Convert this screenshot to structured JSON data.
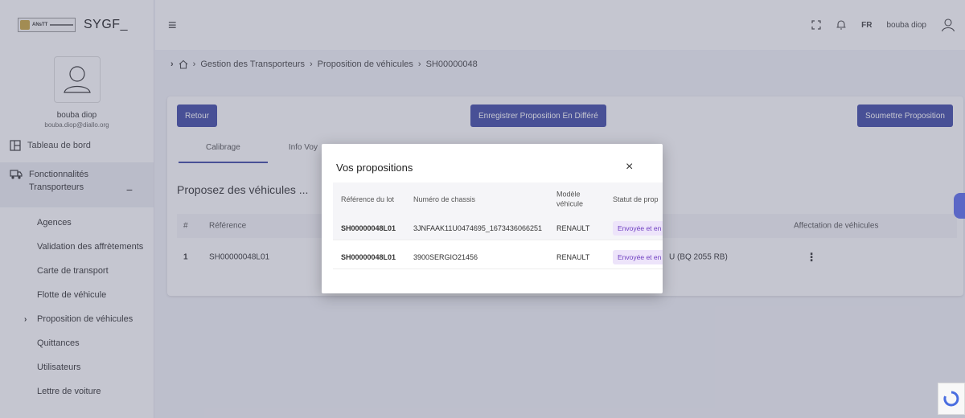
{
  "brand": {
    "logo_text": "ANsTT",
    "title": "SYGF_"
  },
  "user": {
    "name": "bouba diop",
    "email": "bouba.diop@diallo.org"
  },
  "sidebar": {
    "dashboard": "Tableau de bord",
    "group_label": "Fonctionnalités Transporteurs",
    "group_toggle": "−",
    "items": [
      {
        "label": "Agences"
      },
      {
        "label": "Validation des affrètements"
      },
      {
        "label": "Carte de transport"
      },
      {
        "label": "Flotte de véhicule"
      },
      {
        "label": "Proposition de véhicules"
      },
      {
        "label": "Quittances"
      },
      {
        "label": "Utilisateurs"
      },
      {
        "label": "Lettre de voiture"
      }
    ]
  },
  "topbar": {
    "lang": "FR",
    "user_name": "bouba diop"
  },
  "breadcrumb": [
    "Gestion des Transporteurs",
    "Proposition de véhicules",
    "SH00000048"
  ],
  "actions": {
    "back": "Retour",
    "save_later": "Enregistrer Proposition En Différé",
    "submit": "Soumettre Proposition"
  },
  "tabs": [
    "Calibrage",
    "Info Voy"
  ],
  "section_title": "Proposez des véhicules ...",
  "table": {
    "headers": [
      "#",
      "Référence",
      "Affectation de véhicules"
    ],
    "row": {
      "index": "1",
      "reference": "SH00000048L01",
      "vehicle_suffix": "U (BQ 2055 RB)"
    }
  },
  "modal": {
    "title": "Vos propositions",
    "close": "×",
    "headers": [
      "Référence du lot",
      "Numéro de chassis",
      "Modèle véhicule",
      "Statut de prop"
    ],
    "rows": [
      {
        "lot": "SH00000048L01",
        "chassis": "3JNFAAK11U0474695_1673436066251",
        "model": "RENAULT",
        "status": "Envoyée et en"
      },
      {
        "lot": "SH00000048L01",
        "chassis": "3900SERGIO21456",
        "model": "RENAULT",
        "status": "Envoyée et en"
      }
    ]
  }
}
